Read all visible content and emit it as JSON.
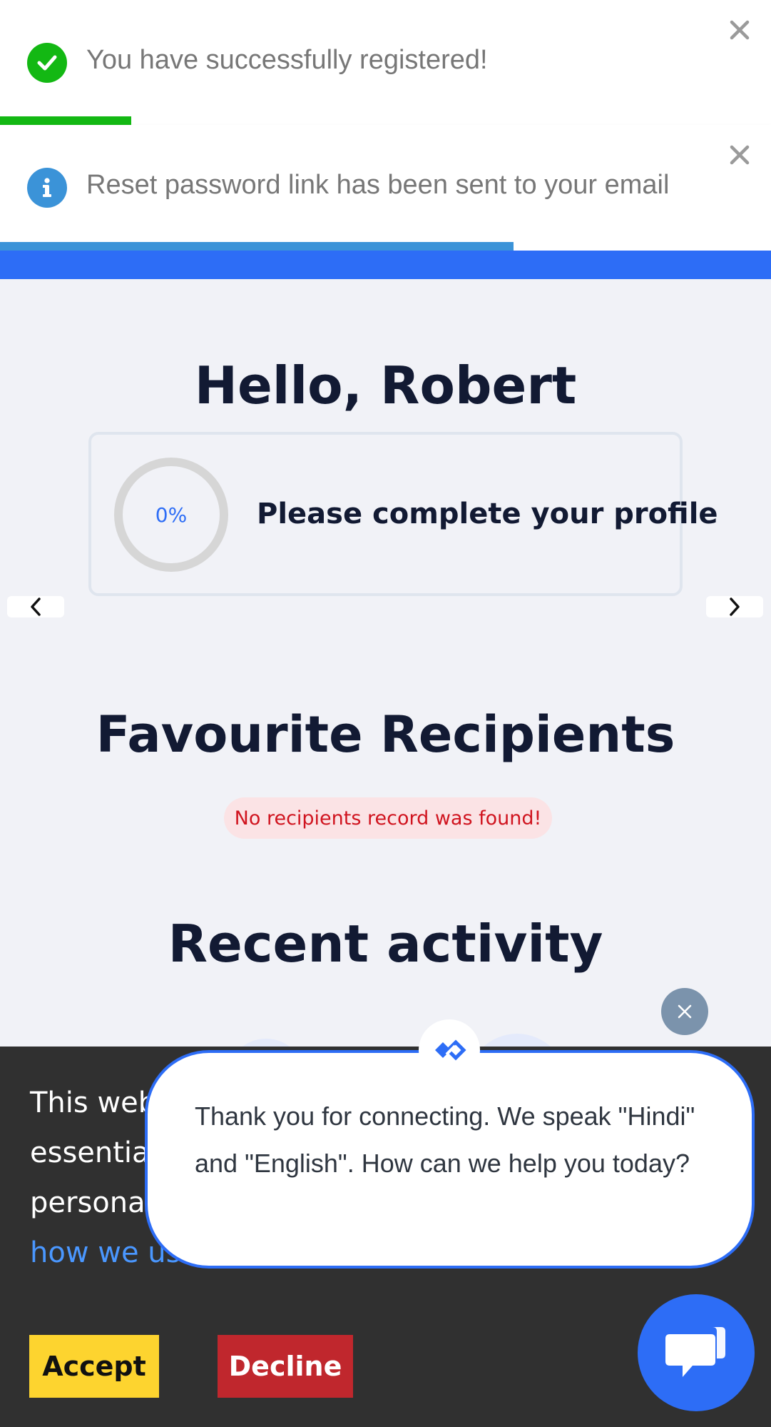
{
  "toasts": [
    {
      "text": "You have successfully registered!",
      "type": "success",
      "icon": "check-icon",
      "progress": 0.17
    },
    {
      "text": "Reset password link has been sent to your email",
      "type": "info",
      "icon": "info-icon",
      "progress": 0.666
    }
  ],
  "greeting": "Hello, Robert",
  "profile": {
    "percent_label": "0%",
    "percent": 0,
    "prompt": "Please complete your profile"
  },
  "favourites": {
    "title": "Favourite Recipients",
    "empty_message": "No recipients record was found!"
  },
  "recent": {
    "title": "Recent activity"
  },
  "cookie": {
    "line1": "This web",
    "line2": "essentia",
    "line3": "persona",
    "link_text": "how we use",
    "accept": "Accept",
    "decline": "Decline"
  },
  "chat": {
    "message": "Thank you for connecting. We speak \"Hindi\" and \"English\". How can we help you today?"
  },
  "colors": {
    "brand_blue": "#2d6df6",
    "success_green": "#13b813",
    "info_blue": "#3b93d8",
    "error_red": "#d0141f",
    "accept_yellow": "#fdd42f",
    "decline_red": "#c0272d"
  }
}
